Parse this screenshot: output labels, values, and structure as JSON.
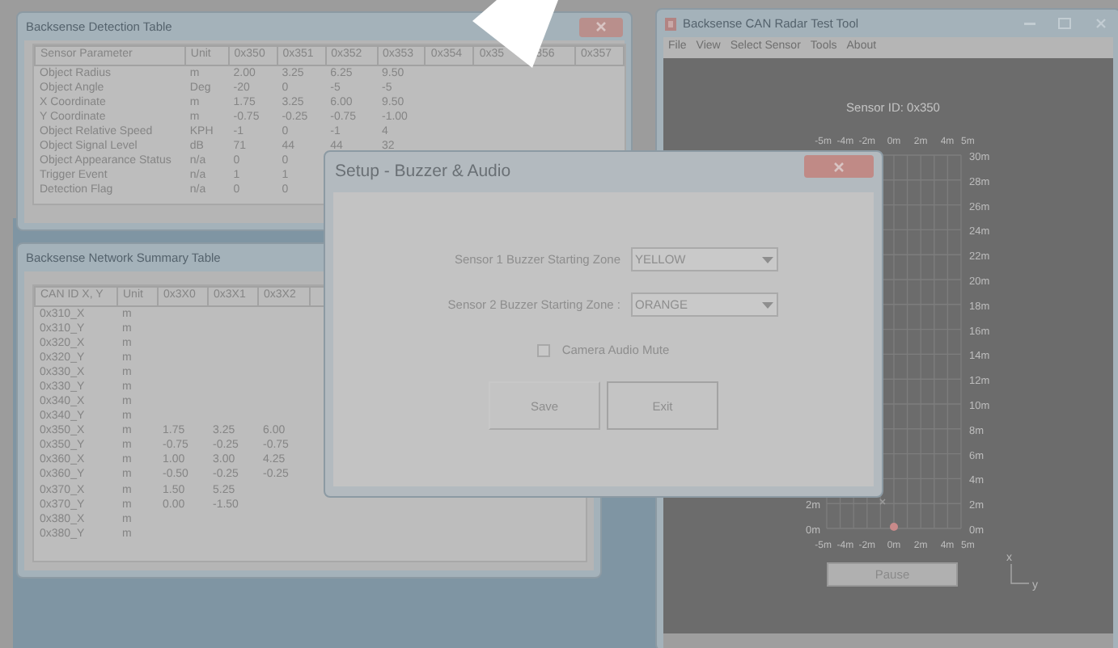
{
  "detection_window": {
    "title": "Backsense Detection Table",
    "columns": [
      "Sensor Parameter",
      "Unit",
      "0x350",
      "0x351",
      "0x352",
      "0x353",
      "0x354",
      "0x35",
      "356",
      "0x357"
    ],
    "rows": [
      [
        "Object Radius",
        "m",
        "2.00",
        "3.25",
        "6.25",
        "9.50"
      ],
      [
        "Object Angle",
        "Deg",
        "-20",
        "0",
        "-5",
        "-5"
      ],
      [
        "X Coordinate",
        "m",
        "1.75",
        "3.25",
        "6.00",
        "9.50"
      ],
      [
        "Y Coordinate",
        "m",
        "-0.75",
        "-0.25",
        "-0.75",
        "-1.00"
      ],
      [
        "Object Relative Speed",
        "KPH",
        "-1",
        "0",
        "-1",
        "4"
      ],
      [
        "Object Signal Level",
        "dB",
        "71",
        "44",
        "44",
        "32"
      ],
      [
        "Object Appearance Status",
        "n/a",
        "0",
        "0"
      ],
      [
        "Trigger Event",
        "n/a",
        "1",
        "1"
      ],
      [
        "Detection Flag",
        "n/a",
        "0",
        "0"
      ]
    ]
  },
  "summary_window": {
    "title": "Backsense Network Summary Table",
    "columns": [
      "CAN ID X, Y",
      "Unit",
      "0x3X0",
      "0x3X1",
      "0x3X2"
    ],
    "rows": [
      [
        "0x310_X",
        "m"
      ],
      [
        "0x310_Y",
        "m"
      ],
      [
        "0x320_X",
        "m"
      ],
      [
        "0x320_Y",
        "m"
      ],
      [
        "0x330_X",
        "m"
      ],
      [
        "0x330_Y",
        "m"
      ],
      [
        "0x340_X",
        "m"
      ],
      [
        "0x340_Y",
        "m"
      ],
      [
        "0x350_X",
        "m",
        "1.75",
        "3.25",
        "6.00"
      ],
      [
        "0x350_Y",
        "m",
        "-0.75",
        "-0.25",
        "-0.75"
      ],
      [
        "0x360_X",
        "m",
        "1.00",
        "3.00",
        "4.25"
      ],
      [
        "0x360_Y",
        "m",
        "-0.50",
        "-0.25",
        "-0.25"
      ],
      [
        "0x370_X",
        "m",
        "1.50",
        "5.25"
      ],
      [
        "0x370_Y",
        "m",
        "0.00",
        "-1.50"
      ],
      [
        "0x380_X",
        "m"
      ],
      [
        "0x380_Y",
        "m"
      ]
    ]
  },
  "radar_window": {
    "title": "Backsense CAN Radar Test Tool",
    "menu": [
      "File",
      "View",
      "Select Sensor",
      "Tools",
      "About"
    ],
    "sensor_label": "Sensor ID: 0x350",
    "top_labels": [
      "-5m",
      "-4m",
      "-2m",
      "0m",
      "2m",
      "4m",
      "5m"
    ],
    "right_labels": [
      "30m",
      "28m",
      "26m",
      "24m",
      "22m",
      "20m",
      "18m",
      "16m",
      "14m",
      "12m",
      "10m",
      "8m",
      "6m",
      "4m",
      "2m",
      "0m"
    ],
    "left_labels": [
      "2m",
      "0m"
    ],
    "bottom_labels": [
      "-5m",
      "-4m",
      "-2m",
      "0m",
      "2m",
      "4m",
      "5m"
    ],
    "axis_x": "x",
    "axis_y": "y",
    "pause_button": "Pause"
  },
  "dialog": {
    "title": "Setup - Buzzer & Audio",
    "fields": [
      {
        "label": "Sensor 1 Buzzer Starting Zone",
        "value": "YELLOW"
      },
      {
        "label": "Sensor 2 Buzzer Starting Zone :",
        "value": "ORANGE"
      }
    ],
    "checkbox": {
      "label": "Camera Audio Mute",
      "checked": false
    },
    "buttons": [
      "Save",
      "Exit"
    ]
  }
}
